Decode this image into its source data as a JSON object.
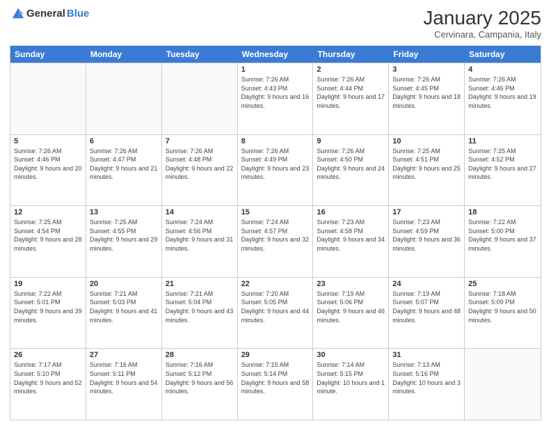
{
  "logo": {
    "general": "General",
    "blue": "Blue"
  },
  "title": "January 2025",
  "location": "Cervinara, Campania, Italy",
  "days_of_week": [
    "Sunday",
    "Monday",
    "Tuesday",
    "Wednesday",
    "Thursday",
    "Friday",
    "Saturday"
  ],
  "weeks": [
    [
      {
        "day": "",
        "info": ""
      },
      {
        "day": "",
        "info": ""
      },
      {
        "day": "",
        "info": ""
      },
      {
        "day": "1",
        "info": "Sunrise: 7:26 AM\nSunset: 4:43 PM\nDaylight: 9 hours and 16 minutes."
      },
      {
        "day": "2",
        "info": "Sunrise: 7:26 AM\nSunset: 4:44 PM\nDaylight: 9 hours and 17 minutes."
      },
      {
        "day": "3",
        "info": "Sunrise: 7:26 AM\nSunset: 4:45 PM\nDaylight: 9 hours and 18 minutes."
      },
      {
        "day": "4",
        "info": "Sunrise: 7:26 AM\nSunset: 4:46 PM\nDaylight: 9 hours and 19 minutes."
      }
    ],
    [
      {
        "day": "5",
        "info": "Sunrise: 7:26 AM\nSunset: 4:46 PM\nDaylight: 9 hours and 20 minutes."
      },
      {
        "day": "6",
        "info": "Sunrise: 7:26 AM\nSunset: 4:47 PM\nDaylight: 9 hours and 21 minutes."
      },
      {
        "day": "7",
        "info": "Sunrise: 7:26 AM\nSunset: 4:48 PM\nDaylight: 9 hours and 22 minutes."
      },
      {
        "day": "8",
        "info": "Sunrise: 7:26 AM\nSunset: 4:49 PM\nDaylight: 9 hours and 23 minutes."
      },
      {
        "day": "9",
        "info": "Sunrise: 7:26 AM\nSunset: 4:50 PM\nDaylight: 9 hours and 24 minutes."
      },
      {
        "day": "10",
        "info": "Sunrise: 7:25 AM\nSunset: 4:51 PM\nDaylight: 9 hours and 25 minutes."
      },
      {
        "day": "11",
        "info": "Sunrise: 7:25 AM\nSunset: 4:52 PM\nDaylight: 9 hours and 27 minutes."
      }
    ],
    [
      {
        "day": "12",
        "info": "Sunrise: 7:25 AM\nSunset: 4:54 PM\nDaylight: 9 hours and 28 minutes."
      },
      {
        "day": "13",
        "info": "Sunrise: 7:25 AM\nSunset: 4:55 PM\nDaylight: 9 hours and 29 minutes."
      },
      {
        "day": "14",
        "info": "Sunrise: 7:24 AM\nSunset: 4:56 PM\nDaylight: 9 hours and 31 minutes."
      },
      {
        "day": "15",
        "info": "Sunrise: 7:24 AM\nSunset: 4:57 PM\nDaylight: 9 hours and 32 minutes."
      },
      {
        "day": "16",
        "info": "Sunrise: 7:23 AM\nSunset: 4:58 PM\nDaylight: 9 hours and 34 minutes."
      },
      {
        "day": "17",
        "info": "Sunrise: 7:23 AM\nSunset: 4:59 PM\nDaylight: 9 hours and 36 minutes."
      },
      {
        "day": "18",
        "info": "Sunrise: 7:22 AM\nSunset: 5:00 PM\nDaylight: 9 hours and 37 minutes."
      }
    ],
    [
      {
        "day": "19",
        "info": "Sunrise: 7:22 AM\nSunset: 5:01 PM\nDaylight: 9 hours and 39 minutes."
      },
      {
        "day": "20",
        "info": "Sunrise: 7:21 AM\nSunset: 5:03 PM\nDaylight: 9 hours and 41 minutes."
      },
      {
        "day": "21",
        "info": "Sunrise: 7:21 AM\nSunset: 5:04 PM\nDaylight: 9 hours and 43 minutes."
      },
      {
        "day": "22",
        "info": "Sunrise: 7:20 AM\nSunset: 5:05 PM\nDaylight: 9 hours and 44 minutes."
      },
      {
        "day": "23",
        "info": "Sunrise: 7:19 AM\nSunset: 5:06 PM\nDaylight: 9 hours and 46 minutes."
      },
      {
        "day": "24",
        "info": "Sunrise: 7:19 AM\nSunset: 5:07 PM\nDaylight: 9 hours and 48 minutes."
      },
      {
        "day": "25",
        "info": "Sunrise: 7:18 AM\nSunset: 5:09 PM\nDaylight: 9 hours and 50 minutes."
      }
    ],
    [
      {
        "day": "26",
        "info": "Sunrise: 7:17 AM\nSunset: 5:10 PM\nDaylight: 9 hours and 52 minutes."
      },
      {
        "day": "27",
        "info": "Sunrise: 7:16 AM\nSunset: 5:11 PM\nDaylight: 9 hours and 54 minutes."
      },
      {
        "day": "28",
        "info": "Sunrise: 7:16 AM\nSunset: 5:12 PM\nDaylight: 9 hours and 56 minutes."
      },
      {
        "day": "29",
        "info": "Sunrise: 7:15 AM\nSunset: 5:14 PM\nDaylight: 9 hours and 58 minutes."
      },
      {
        "day": "30",
        "info": "Sunrise: 7:14 AM\nSunset: 5:15 PM\nDaylight: 10 hours and 1 minute."
      },
      {
        "day": "31",
        "info": "Sunrise: 7:13 AM\nSunset: 5:16 PM\nDaylight: 10 hours and 3 minutes."
      },
      {
        "day": "",
        "info": ""
      }
    ]
  ]
}
